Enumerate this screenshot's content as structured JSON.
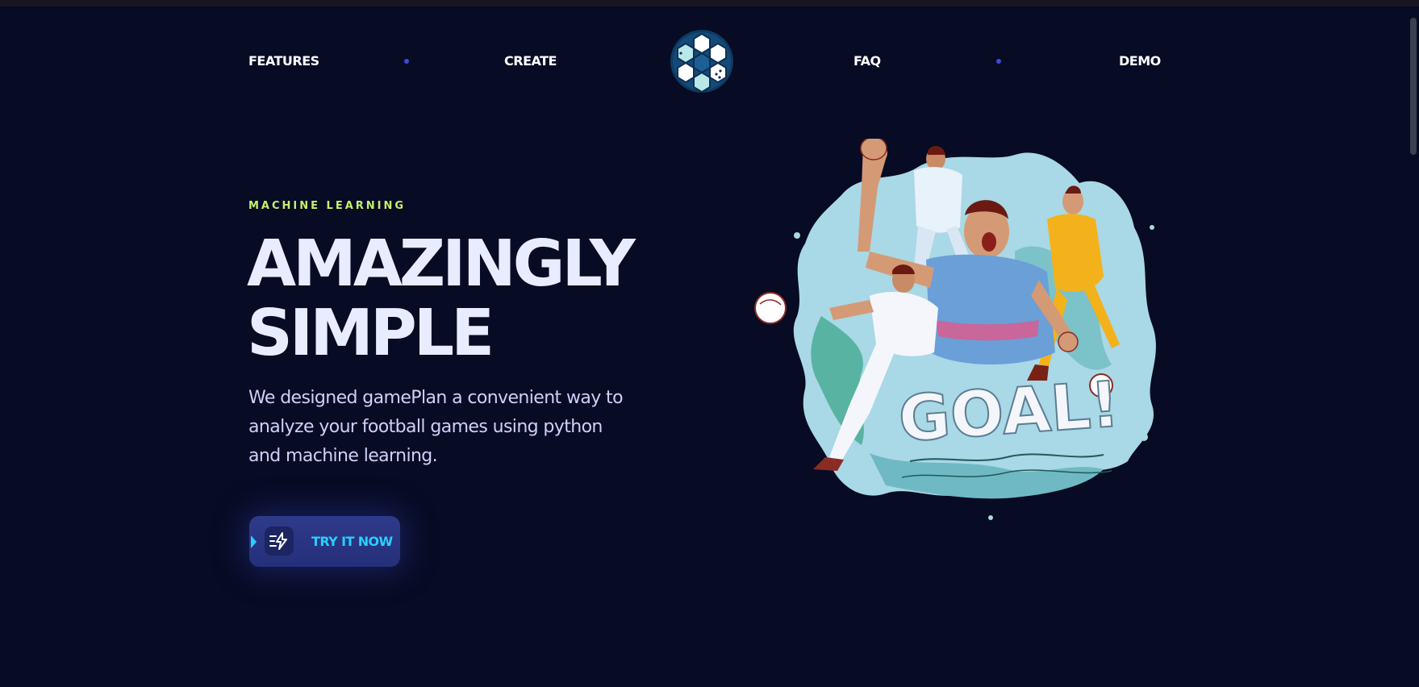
{
  "nav": {
    "left_links": [
      "FEATURES",
      "CREATE"
    ],
    "right_links": [
      "FAQ",
      "DEMO"
    ],
    "logo_icon": "soccer-ball-hex-icon"
  },
  "hero": {
    "eyebrow": "MACHINE LEARNING",
    "headline_line1": "AMAZINGLY",
    "headline_line2": "SIMPLE",
    "description": "We designed gamePlan a convenient way to analyze your football games using python and machine learning.",
    "cta_label": "TRY IT NOW",
    "cta_icon": "bolt-lines-icon",
    "illustration": {
      "icon": "football-players-goal-illustration",
      "lettering": "GOAL!"
    }
  },
  "colors": {
    "background": "#070b24",
    "eyebrow": "#c3f06a",
    "headline": "#e9ecff",
    "body_text": "#cdd1f7",
    "nav_dot": "#3a4cdc",
    "cta_bg": "#2b3583",
    "cta_text": "#27d0ff"
  }
}
